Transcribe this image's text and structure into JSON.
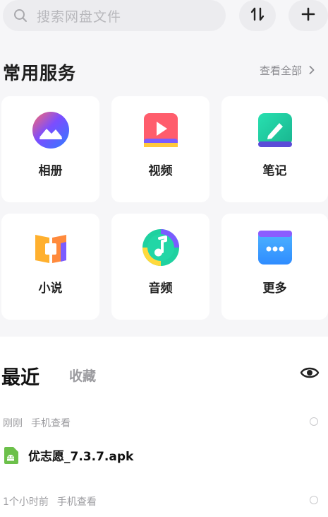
{
  "search": {
    "placeholder": "搜索网盘文件"
  },
  "toolbar": {
    "sort_icon": "sort-arrows-icon",
    "add_icon": "plus-icon"
  },
  "services": {
    "title": "常用服务",
    "view_all": "查看全部",
    "items": [
      {
        "label": "相册",
        "icon": "album-icon"
      },
      {
        "label": "视频",
        "icon": "video-icon"
      },
      {
        "label": "笔记",
        "icon": "note-icon"
      },
      {
        "label": "小说",
        "icon": "novel-icon"
      },
      {
        "label": "音频",
        "icon": "audio-icon"
      },
      {
        "label": "更多",
        "icon": "more-icon"
      }
    ]
  },
  "recent": {
    "tabs": [
      {
        "label": "最近",
        "active": true
      },
      {
        "label": "收藏",
        "active": false
      }
    ],
    "groups": [
      {
        "time": "刚刚",
        "source": "手机查看",
        "file": "优志愿_7.3.7.apk"
      },
      {
        "time": "1个小时前",
        "source": "手机查看"
      }
    ]
  },
  "colors": {
    "accent_green": "#6cc04a",
    "page_bg": "#f6f6f8"
  }
}
